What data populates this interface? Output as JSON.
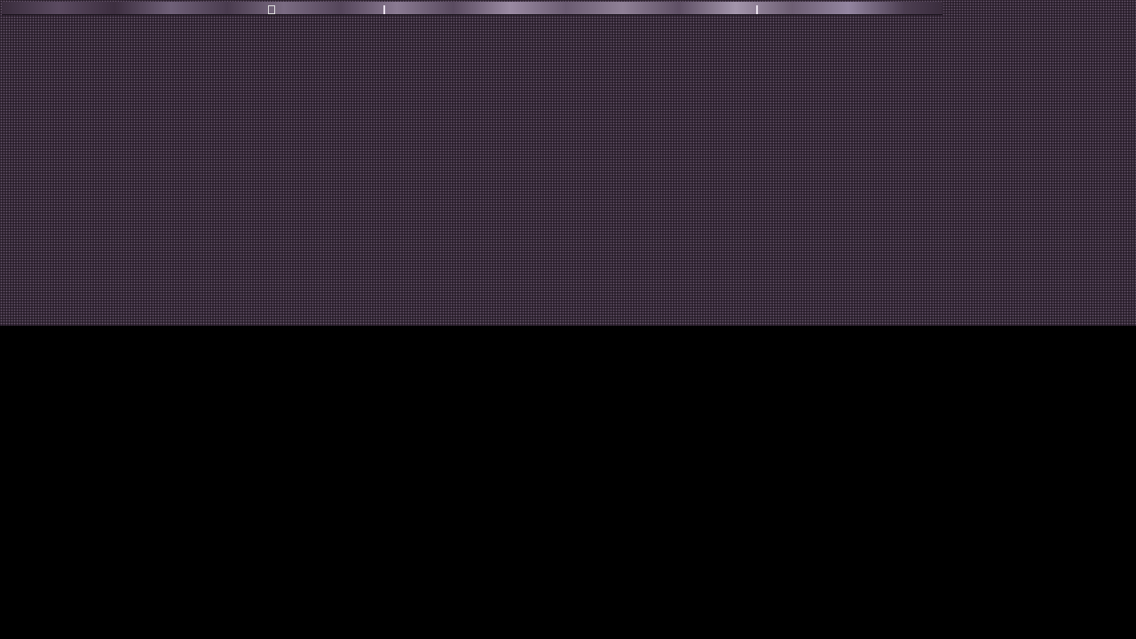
{
  "screen": {
    "background_color": "#000000",
    "backdrop_color": "#2a1f2c",
    "dot_color": "#6a5a70"
  },
  "top_strip": {
    "content": "image-strip"
  }
}
